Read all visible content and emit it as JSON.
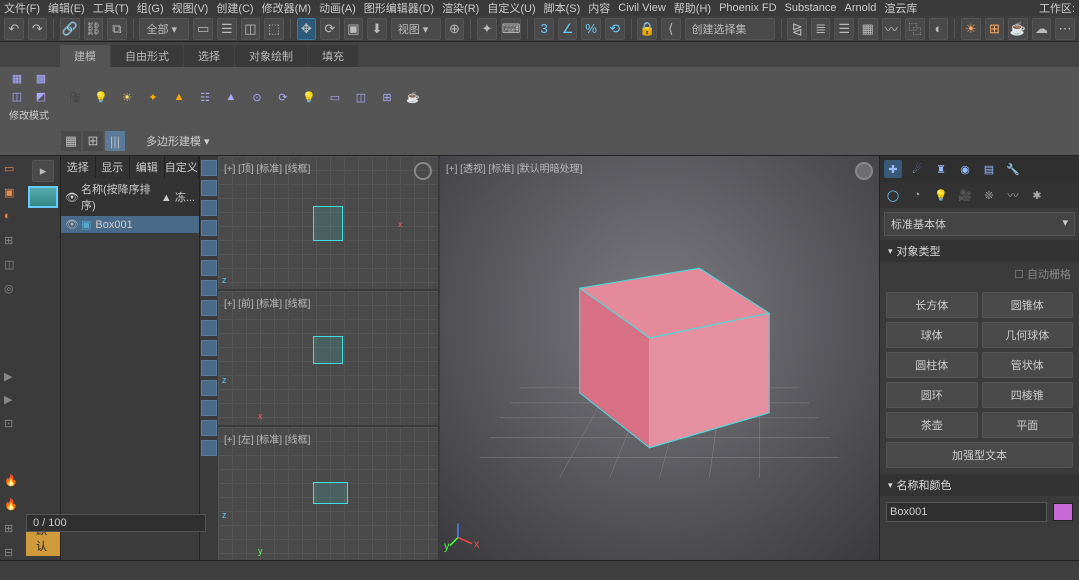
{
  "menu": {
    "items": [
      "文件(F)",
      "编辑(E)",
      "工具(T)",
      "组(G)",
      "视图(V)",
      "创建(C)",
      "修改器(M)",
      "动画(A)",
      "图形编辑器(D)",
      "渲染(R)",
      "自定义(U)",
      "脚本(S)",
      "内容",
      "Civil View",
      "帮助(H)",
      "Phoenix FD",
      "Substance",
      "Arnold",
      "渲云库"
    ],
    "workspace": "工作区:"
  },
  "ribbon": {
    "tabs": [
      "建模",
      "自由形式",
      "选择",
      "对象绘制",
      "填充"
    ],
    "mod_label": "修改模式",
    "poly_label": "多边形建模 ▾"
  },
  "toolbar1": {
    "dropdown1": "全部 ▾",
    "dropdown2": "视图 ▾",
    "sel_label": "创建选择集"
  },
  "scene": {
    "tabs": [
      "选择",
      "显示",
      "编辑",
      "自定义"
    ],
    "header_name": "名称(按降序排序)",
    "header_extra": "▲ 冻...",
    "rows": [
      {
        "name": "Box001"
      }
    ]
  },
  "viewports": {
    "top": "[+] [顶] [标准] [线框]",
    "front": "[+] [前] [标准] [线框]",
    "left": "[+] [左] [标准] [线框]",
    "persp": "[+] [透视] [标准] [默认明暗处理]"
  },
  "right": {
    "primitives_drop": "标准基本体",
    "section_objtype": "对象类型",
    "autogrid": "自动栅格",
    "buttons": [
      "长方体",
      "圆锥体",
      "球体",
      "几何球体",
      "圆柱体",
      "管状体",
      "圆环",
      "四棱锥",
      "茶壶",
      "平面",
      "加强型文本"
    ],
    "section_nameclr": "名称和颜色",
    "name_value": "Box001"
  },
  "status": {
    "default_tab": "默认",
    "timeline": "0   /   100"
  }
}
